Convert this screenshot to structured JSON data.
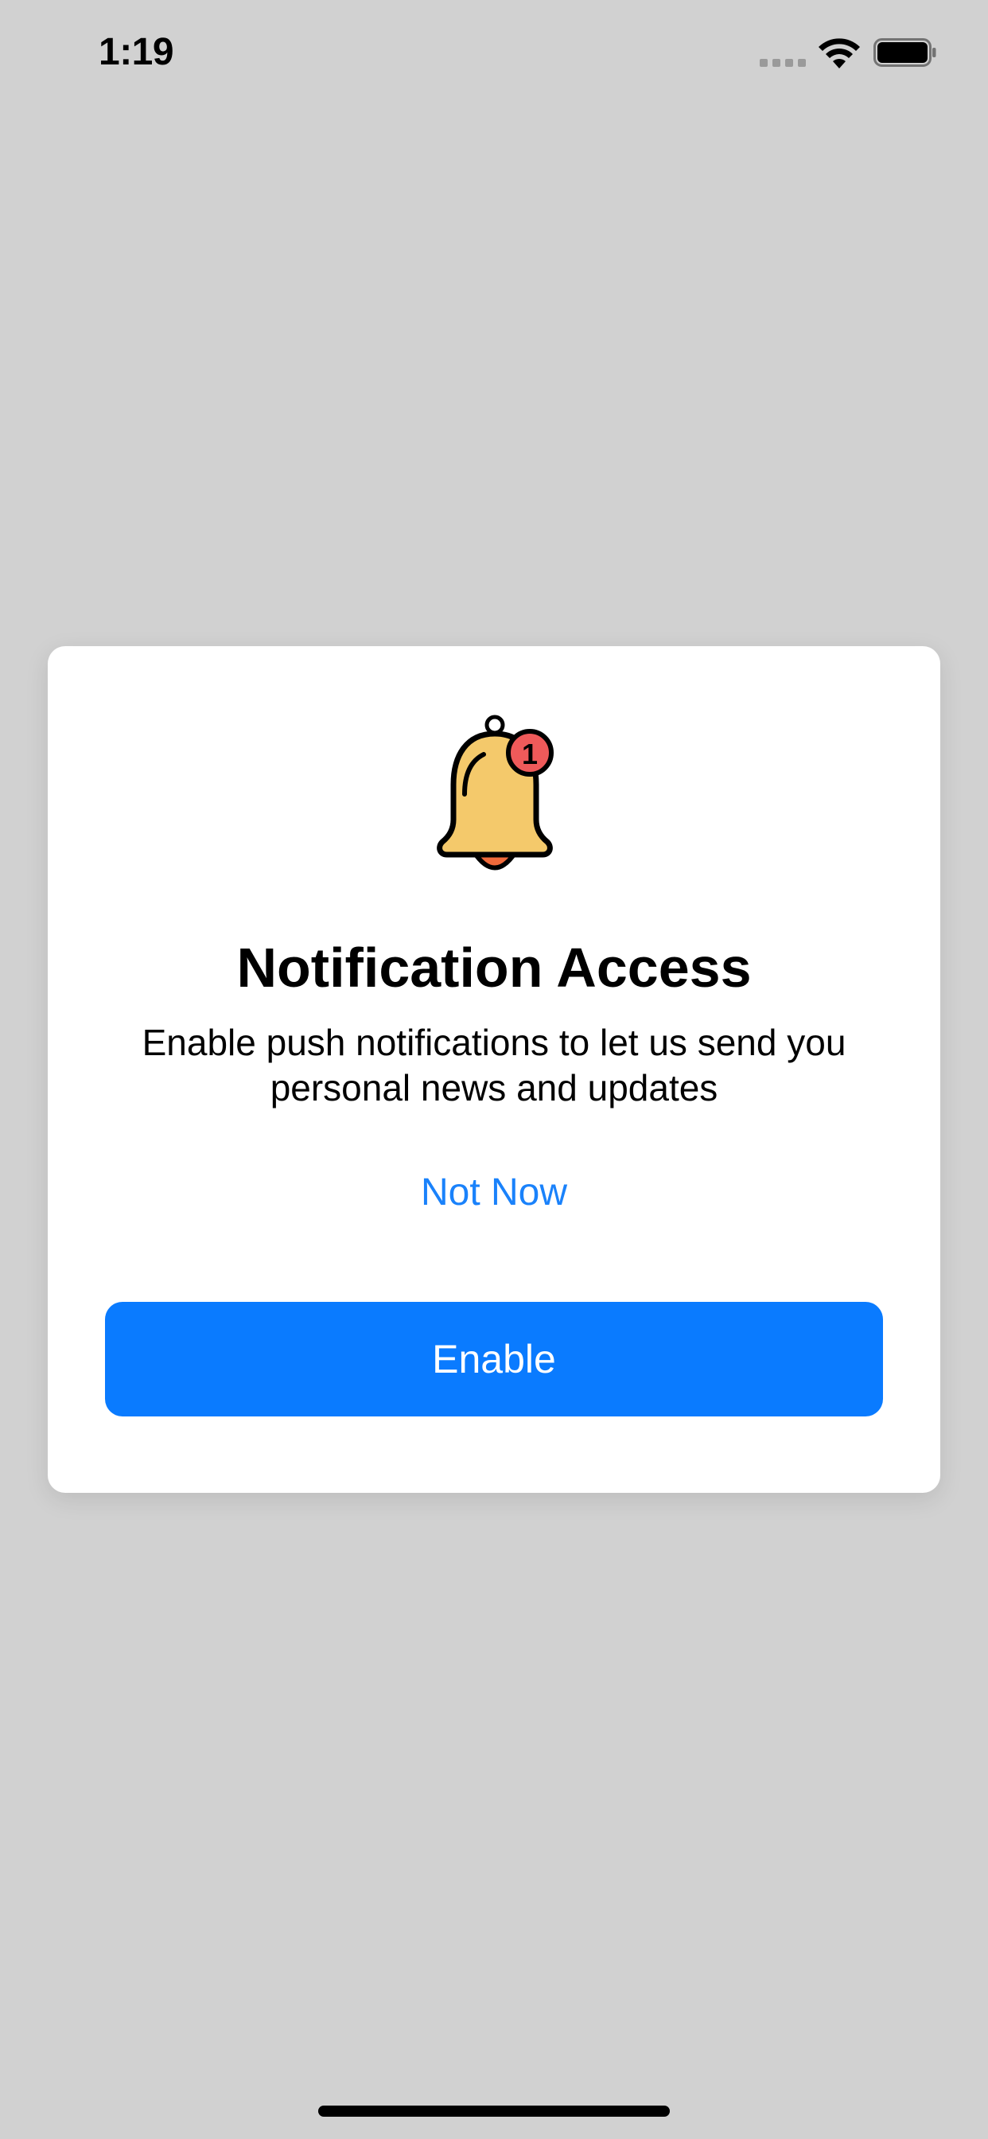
{
  "status_bar": {
    "time": "1:19",
    "icons": [
      "cellular-signal-icon",
      "wifi-icon",
      "battery-icon"
    ]
  },
  "dialog": {
    "icon": "notification-bell-icon",
    "badge_count": "1",
    "title": "Notification Access",
    "message": "Enable push notifications to let us send you personal news and updates",
    "secondary_button": "Not Now",
    "primary_button": "Enable"
  },
  "colors": {
    "background": "#d1d1d1",
    "card": "#ffffff",
    "accent": "#0a7bff",
    "link": "#1a82fb",
    "bell_body": "#f4c96b",
    "bell_clapper": "#f06a3b",
    "badge": "#ef5a5a"
  }
}
